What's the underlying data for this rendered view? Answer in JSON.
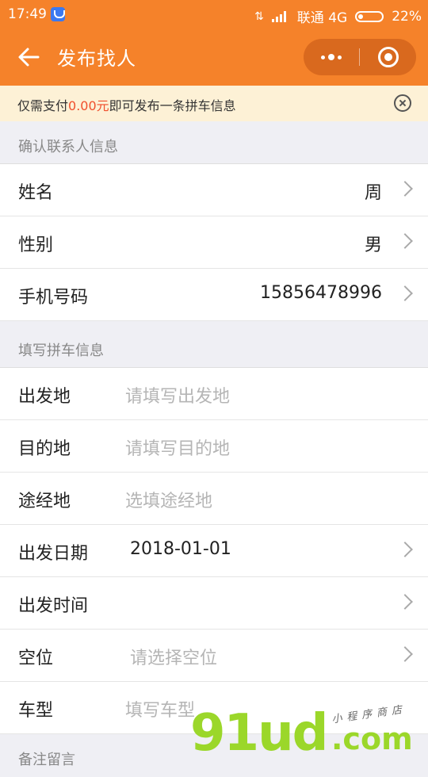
{
  "status_bar": {
    "time": "17:49",
    "carrier": "联通 4G",
    "battery": "22%"
  },
  "nav": {
    "title": "发布找人"
  },
  "notice": {
    "prefix": "仅需支付",
    "amount": "0.00元",
    "suffix": "即可发布一条拼车信息"
  },
  "contact_section": {
    "title": "确认联系人信息",
    "rows": [
      {
        "label": "姓名",
        "value": "周"
      },
      {
        "label": "性别",
        "value": "男"
      },
      {
        "label": "手机号码",
        "value": "15856478996"
      }
    ]
  },
  "trip_section": {
    "title": "填写拼车信息",
    "departure": {
      "label": "出发地",
      "placeholder": "请填写出发地"
    },
    "destination": {
      "label": "目的地",
      "placeholder": "请填写目的地"
    },
    "via": {
      "label": "途经地",
      "placeholder": "选填途经地"
    },
    "date": {
      "label": "出发日期",
      "value": "2018-01-01"
    },
    "time": {
      "label": "出发时间",
      "value": ""
    },
    "seats": {
      "label": "空位",
      "placeholder": "请选择空位"
    },
    "car_model": {
      "label": "车型",
      "placeholder": "填写车型"
    }
  },
  "remark_section": {
    "title": "备注留言"
  },
  "watermark": {
    "brand": "91ud",
    "domain": ".com",
    "tagline": "小程序商店"
  },
  "colors": {
    "brand_orange": "#f5822a",
    "notice_bg": "#fdf1d6",
    "amount_red": "#f0502d"
  }
}
